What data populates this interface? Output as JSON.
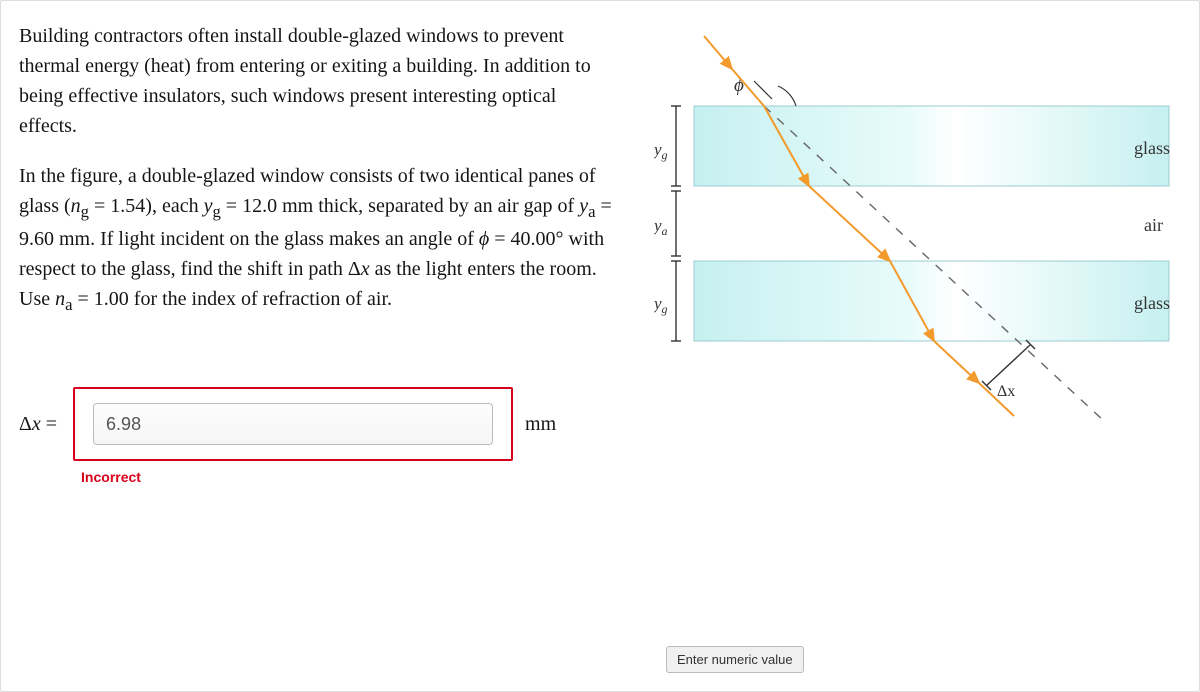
{
  "problem": {
    "para1": "Building contractors often install double-glazed windows to prevent thermal energy (heat) from entering or exiting a building. In addition to being effective insulators, such windows present interesting optical effects.",
    "para2_pre": "In the figure, a double-glazed window consists of two identical panes of glass (",
    "ng_label": "n",
    "ng_sub": "g",
    "ng_eq": " = 1.54), each ",
    "yg_label": "y",
    "yg_sub": "g",
    "yg_eq": " = 12.0 mm thick, separated by an air gap of ",
    "ya_label": "y",
    "ya_sub": "a",
    "ya_eq": " = 9.60 mm. If light incident on the glass makes an angle of ",
    "phi_label": "ϕ",
    "phi_eq": " = 40.00° with respect to the glass, find the shift in path Δ",
    "dx_var": "x",
    "para2_mid": " as the light enters the room. Use ",
    "na_label": "n",
    "na_sub": "a",
    "na_eq": " = 1.00 for the index of refraction of air."
  },
  "answer": {
    "label_pre": "Δ",
    "label_var": "x",
    "label_post": " =",
    "value": "6.98",
    "unit": "mm",
    "feedback": "Incorrect"
  },
  "tooltip": "Enter numeric value",
  "diagram": {
    "top_layer": "glass",
    "mid_layer": "air",
    "bottom_layer": "glass",
    "phi": "ϕ",
    "yg": "y",
    "yg_sub": "g",
    "ya": "y",
    "ya_sub": "a",
    "dx": "Δx"
  }
}
